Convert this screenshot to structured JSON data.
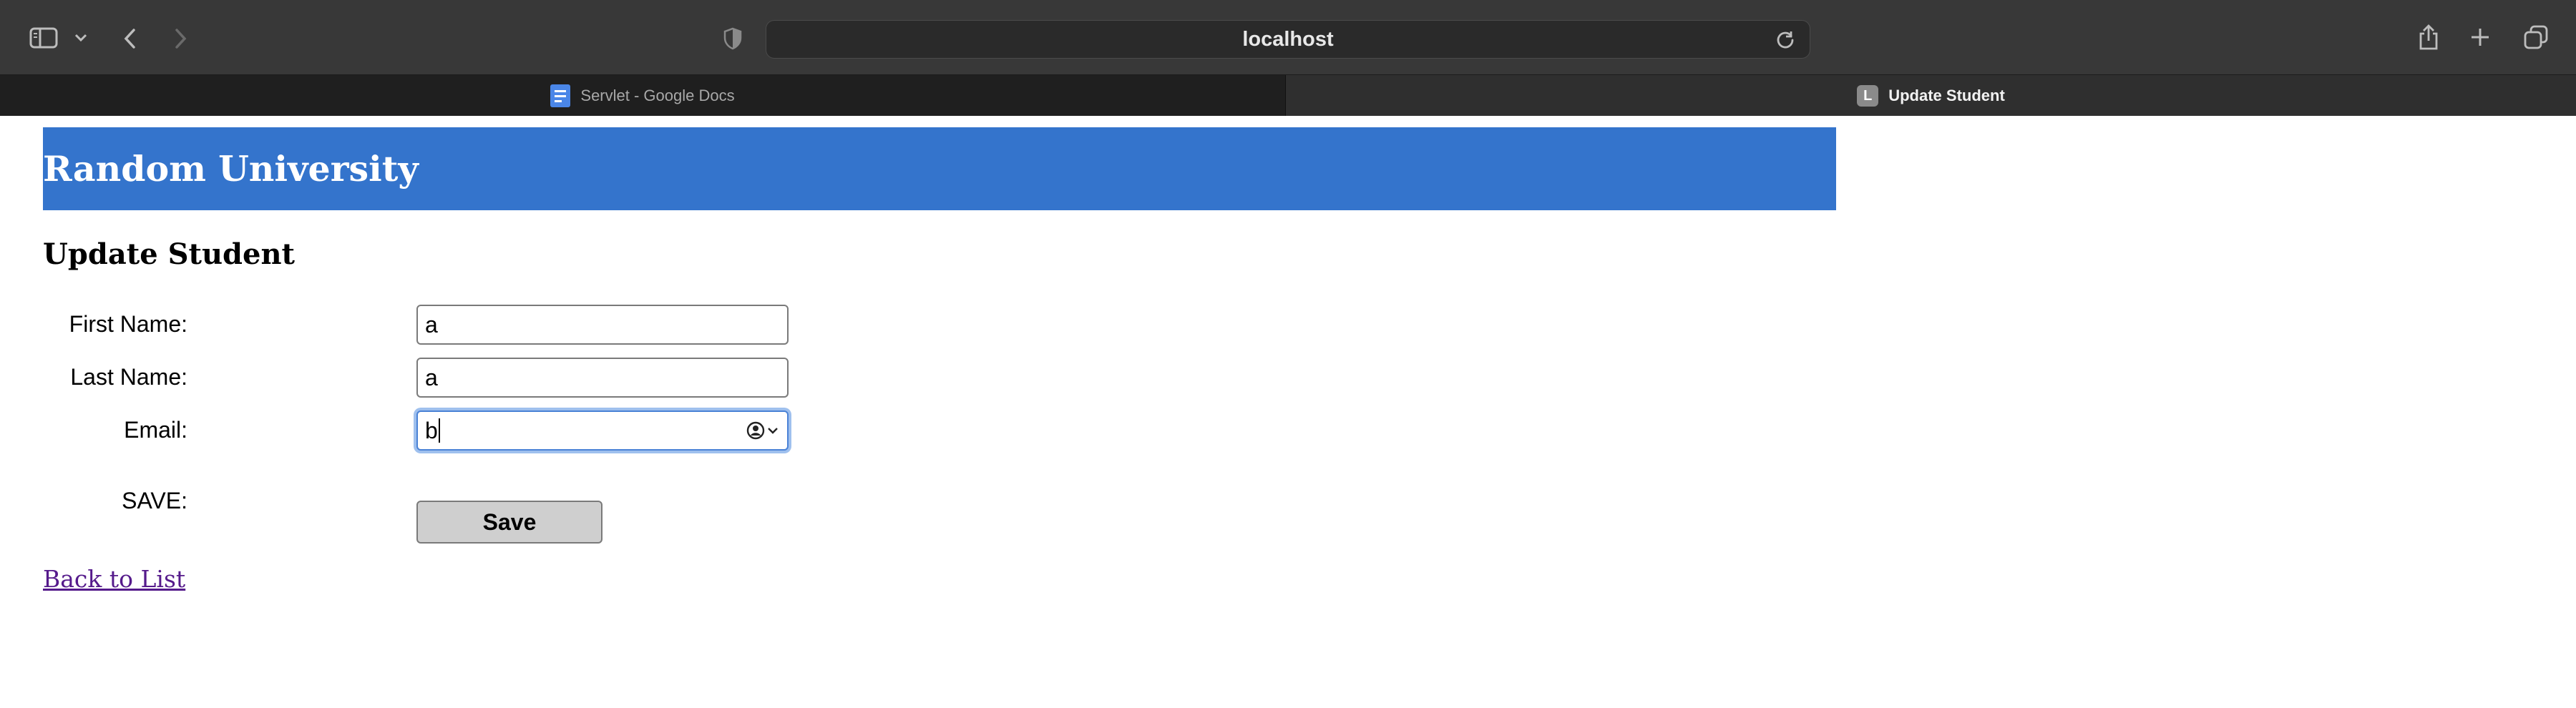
{
  "browser": {
    "url": "localhost",
    "tabs": [
      {
        "title": "Servlet - Google Docs",
        "active": false,
        "favicon": "google-docs-icon"
      },
      {
        "title": "Update Student",
        "active": true,
        "favicon_letter": "L"
      }
    ],
    "colors": {
      "toolbar": "#383838",
      "tabstrip": "#2c2c2c"
    }
  },
  "header": {
    "site_title": "Random University",
    "color": "#3474cc"
  },
  "page": {
    "heading": "Update Student"
  },
  "form": {
    "first_name": {
      "label": "First Name:",
      "value": "a"
    },
    "last_name": {
      "label": "Last Name:",
      "value": "a"
    },
    "email": {
      "label": "Email:",
      "value": "b",
      "focused": true
    },
    "save": {
      "label": "SAVE:",
      "button": "Save"
    }
  },
  "links": {
    "back": "Back to List"
  }
}
